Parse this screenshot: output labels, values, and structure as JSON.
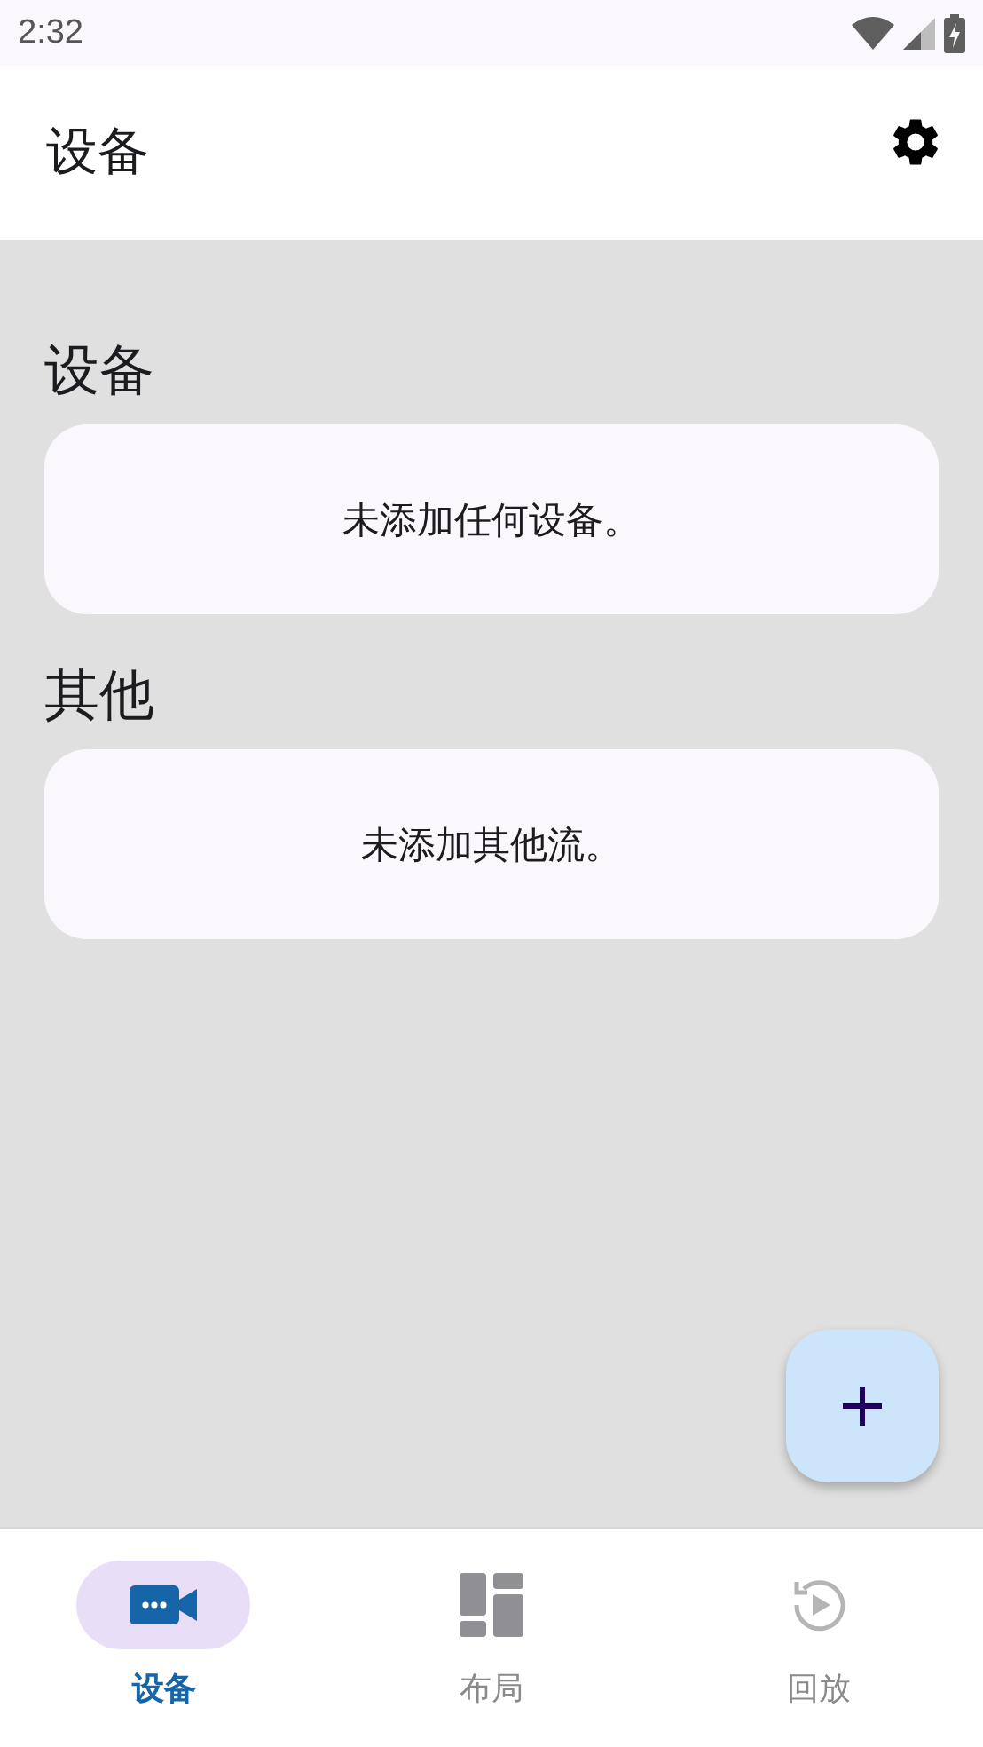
{
  "status_bar": {
    "time": "2:32"
  },
  "app_bar": {
    "title": "设备"
  },
  "sections": [
    {
      "title": "设备",
      "empty_message": "未添加任何设备。"
    },
    {
      "title": "其他",
      "empty_message": "未添加其他流。"
    }
  ],
  "nav": [
    {
      "label": "设备",
      "kind": "camera",
      "selected": true
    },
    {
      "label": "布局",
      "kind": "layout",
      "selected": false
    },
    {
      "label": "回放",
      "kind": "replay",
      "selected": false
    }
  ]
}
